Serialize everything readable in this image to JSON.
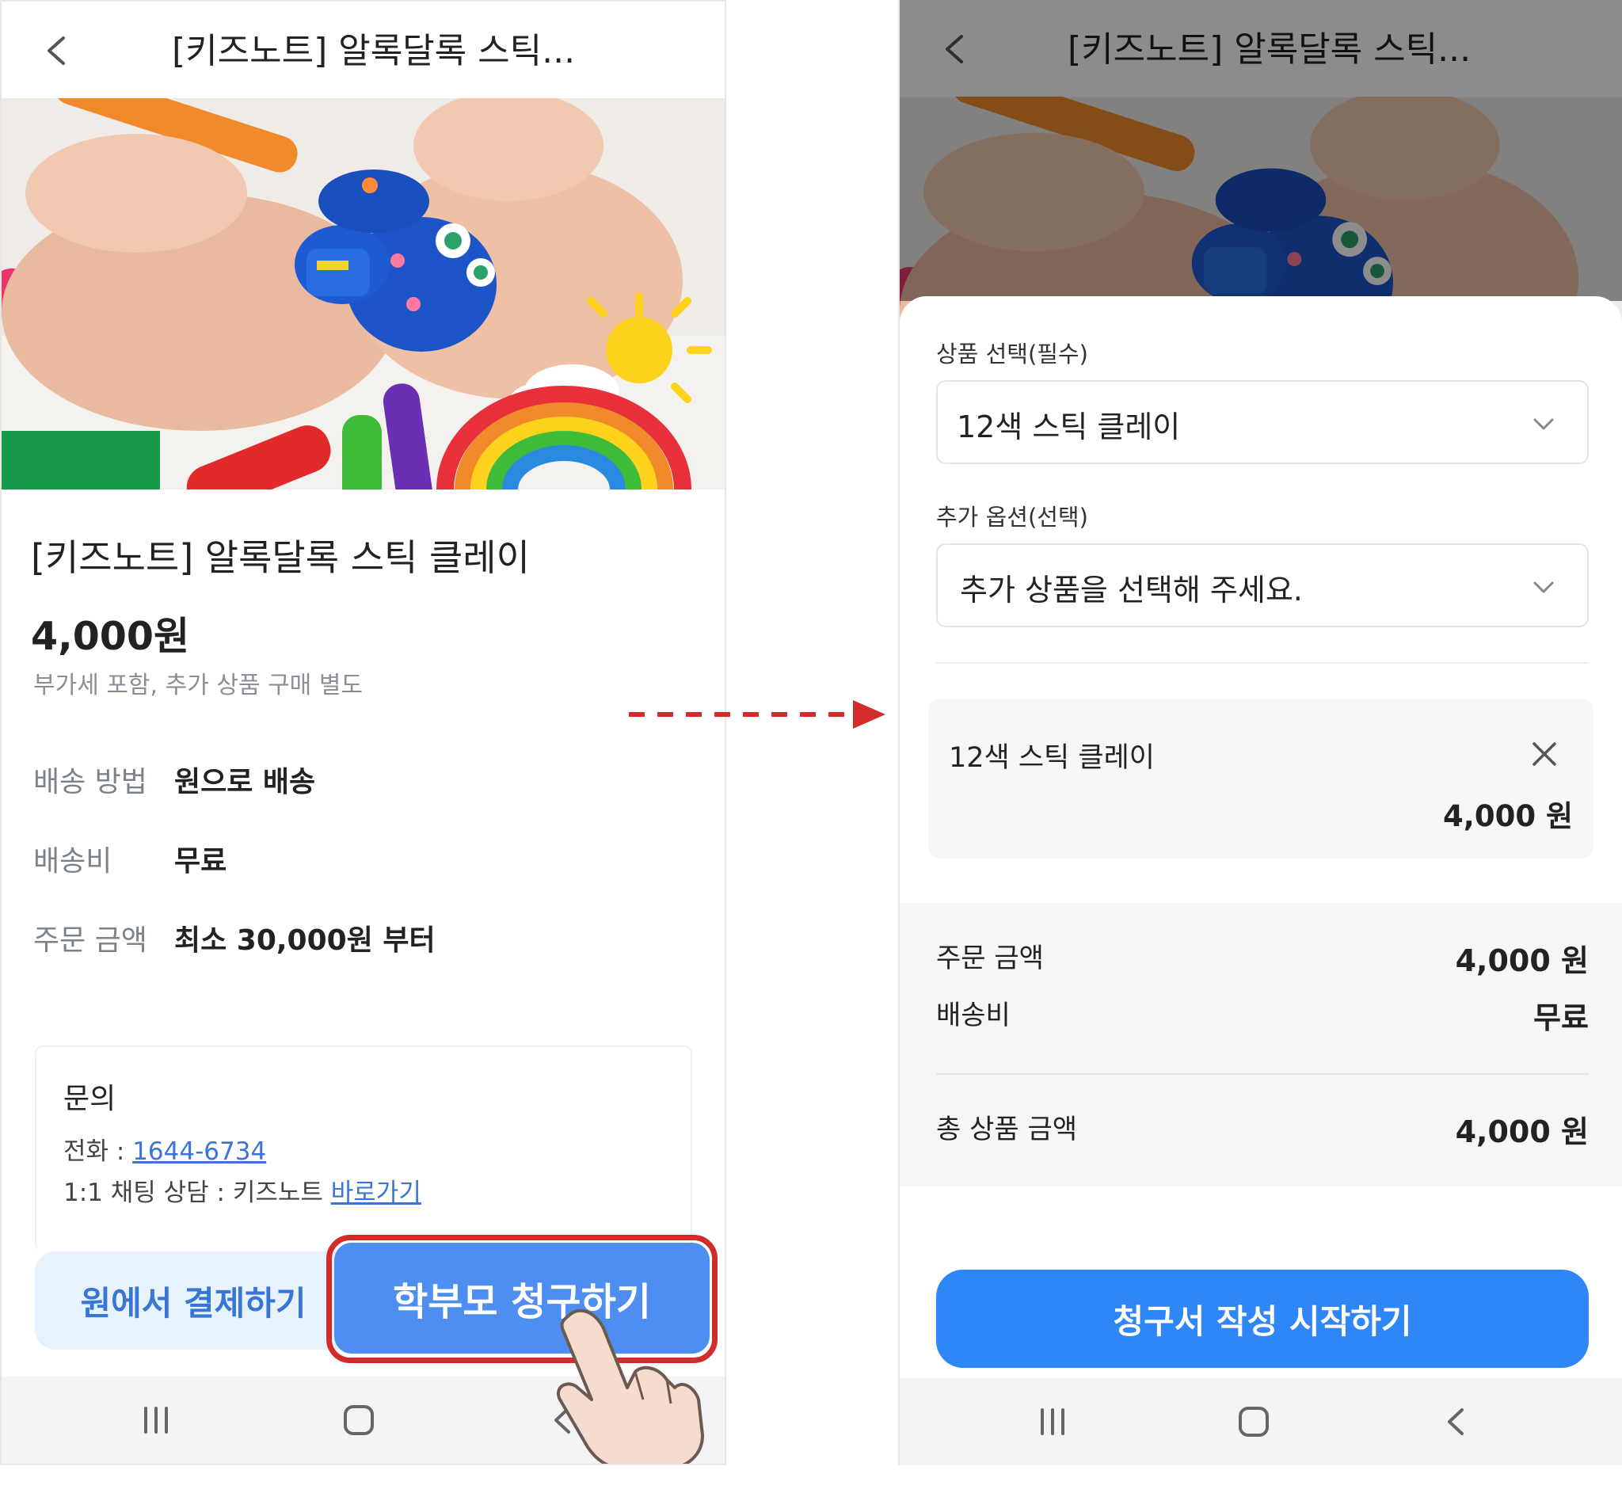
{
  "left": {
    "appbar": {
      "title": "[키즈노트] 알록달록 스틱..."
    },
    "product": {
      "name": "[키즈노트] 알록달록 스틱 클레이",
      "price": "4,000원",
      "price_note": "부가세 포함, 추가 상품 구매 별도"
    },
    "info": [
      {
        "key": "배송 방법",
        "value": "원으로 배송"
      },
      {
        "key": "배송비",
        "value": "무료"
      },
      {
        "key": "주문 금액",
        "value": "최소 30,000원 부터"
      }
    ],
    "inquiry": {
      "title": "문의",
      "phone_label": "전화 : ",
      "phone": "1644-6734",
      "chat_label": "1:1 채팅 상담 : 키즈노트 ",
      "chat_link": "바로가기"
    },
    "buttons": {
      "pay": "원에서 결제하기",
      "parent": "학부모 청구하기"
    },
    "highlight_color": "#d32a2a"
  },
  "right": {
    "appbar": {
      "title": "[키즈노트] 알록달록 스틱..."
    },
    "sheet": {
      "product_select_label": "상품 선택(필수)",
      "product_select_value": "12색 스틱 클레이",
      "option_label": "추가 옵션(선택)",
      "option_placeholder": "추가 상품을 선택해 주세요.",
      "selected_item": {
        "name": "12색 스틱 클레이",
        "price": "4,000 원"
      },
      "summary": {
        "order_label": "주문 금액",
        "order_value": "4,000 원",
        "shipping_label": "배송비",
        "shipping_value": "무료",
        "total_label": "총 상품 금액",
        "total_value": "4,000 원"
      },
      "start_button": "청구서 작성 시작하기"
    },
    "accent_color": "#2f86f6"
  },
  "icons": {
    "back": "chevron-left-icon",
    "recents": "recent-apps-icon",
    "home": "home-icon",
    "nav_back": "nav-back-icon",
    "close": "close-icon",
    "dropdown": "chevron-down-icon",
    "tap": "tap-hand-icon",
    "flow_arrow": "dashed-arrow-right-icon"
  }
}
